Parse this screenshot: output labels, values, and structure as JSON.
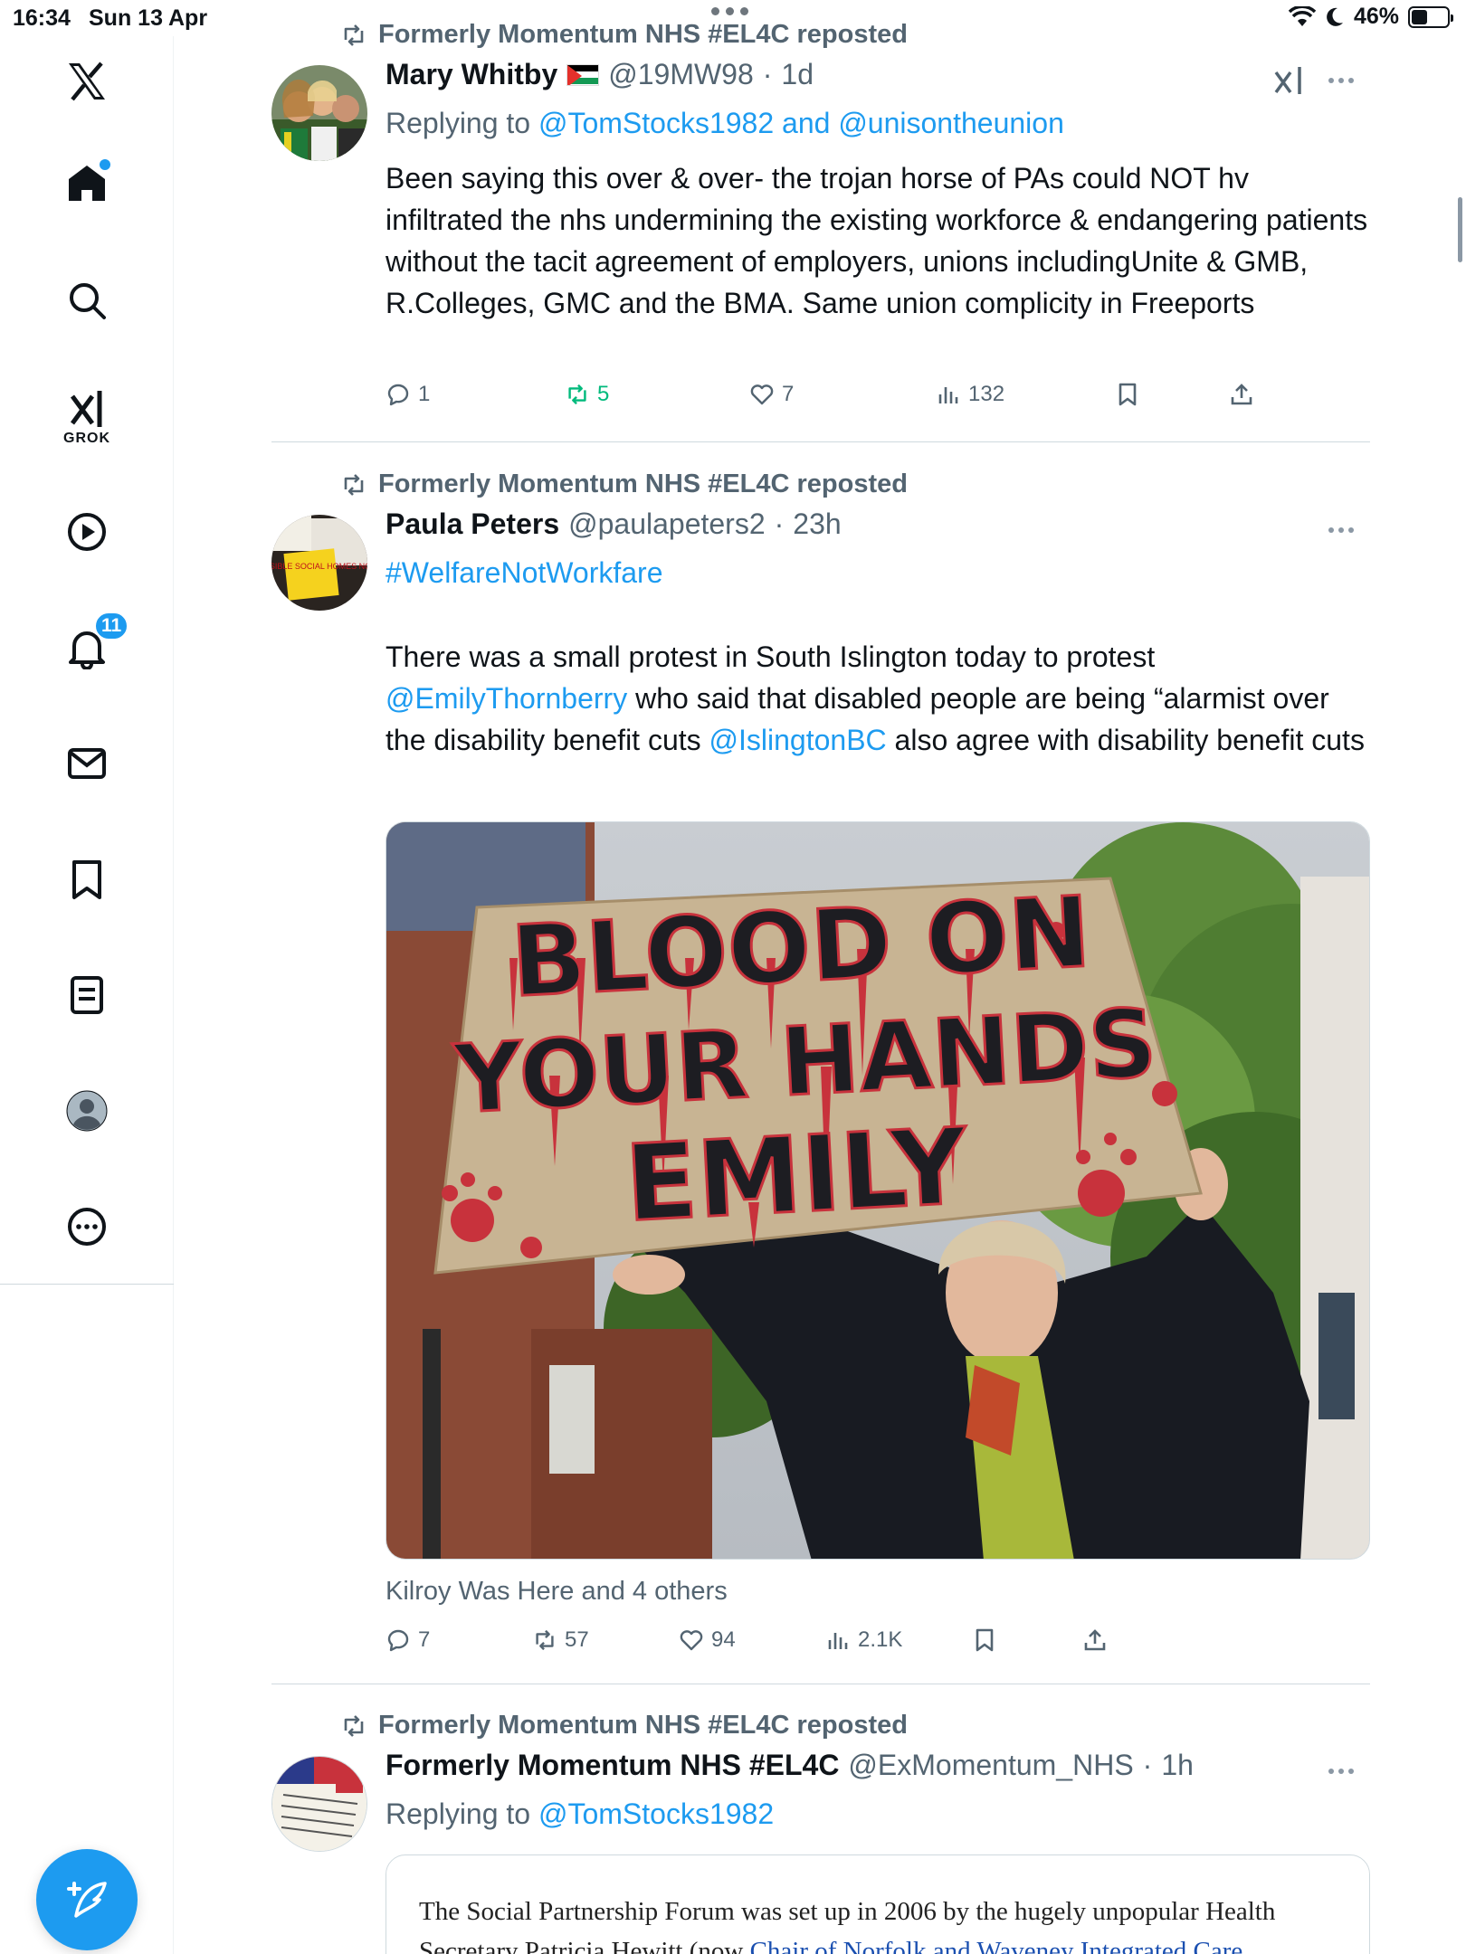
{
  "status": {
    "time": "16:34",
    "date": "Sun 13 Apr",
    "battery": "46%",
    "battery_level": 0.46
  },
  "sidebar": {
    "grok_label": "GROK",
    "notifications_badge": "11",
    "items": [
      "x-logo",
      "home",
      "search",
      "grok",
      "video",
      "notifications",
      "messages",
      "bookmarks",
      "lists",
      "profile",
      "more"
    ]
  },
  "feed": {
    "posts": [
      {
        "repost_label": "Formerly Momentum NHS #EL4C reposted",
        "name": "Mary Whitby",
        "handle": "@19MW98",
        "time": "1d",
        "reply_prefix": "Replying to",
        "reply_to_1": "@TomStocks1982",
        "reply_and": "and",
        "reply_to_2": "@unisontheunion",
        "text": "Been saying this over & over- the trojan horse of PAs could NOT hv infiltrated the nhs undermining the existing workforce & endangering patients without the tacit agreement of employers, unions includingUnite & GMB, R.Colleges, GMC and  the BMA. Same union complicity in Freeports",
        "replies": "1",
        "reposts": "5",
        "likes": "7",
        "views": "132"
      },
      {
        "repost_label": "Formerly Momentum NHS #EL4C reposted",
        "name": "Paula Peters",
        "handle": "@paulapeters2",
        "time": "23h",
        "hashtag": "#WelfareNotWorkfare",
        "text_1": "There was a small protest in South Islington today to protest",
        "mention_1": "@EmilyThornberry",
        "text_2": "who said that disabled people are being “alarmist over the disability benefit cuts",
        "mention_2": "@IslingtonBC",
        "text_3": "also agree with disability benefit cuts",
        "sign_line_1": "BLOOD ON",
        "sign_line_2": "YOUR HANDS",
        "sign_line_3": "EMILY",
        "tagged": "Kilroy Was Here and 4 others",
        "replies": "7",
        "reposts": "57",
        "likes": "94",
        "views": "2.1K",
        "avatar_sign": "ACCESSIBLE SOCIAL HOMES NOW!"
      },
      {
        "repost_label": "Formerly Momentum NHS #EL4C reposted",
        "name": "Formerly Momentum NHS #EL4C",
        "handle": "@ExMomentum_NHS",
        "time": "1h",
        "reply_prefix": "Replying to",
        "reply_to_1": "@TomStocks1982",
        "quote_text": "The Social Partnership Forum was set up in 2006 by the hugely unpopular Health Secretary Patricia Hewitt (now",
        "quote_link": "Chair of Norfolk and Waveney Integrated Care"
      }
    ]
  },
  "colors": {
    "accent": "#1d9bf0",
    "repost_green": "#00ba7c",
    "muted": "#536471",
    "text": "#0f1419"
  }
}
